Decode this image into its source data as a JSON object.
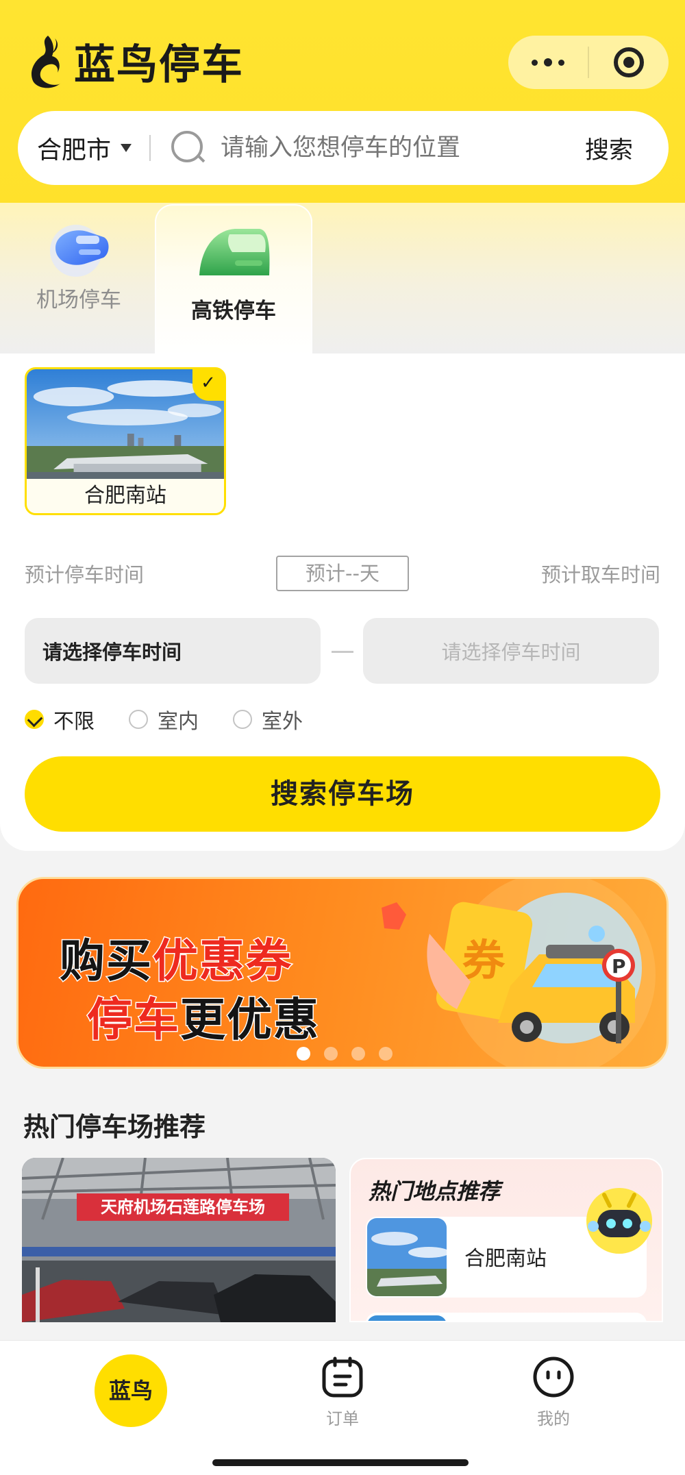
{
  "app": {
    "name": "蓝鸟停车",
    "accent_color": "#ffde00",
    "icons": {
      "logo": "bird-flame-logo",
      "more": "more-dots-icon",
      "close": "target-circle-icon"
    }
  },
  "search": {
    "city": "合肥市",
    "placeholder": "请输入您想停车的位置",
    "button": "搜索"
  },
  "tabs": [
    {
      "label": "机场停车",
      "icon": "airplane-icon",
      "active": false
    },
    {
      "label": "高铁停车",
      "icon": "high-speed-train-icon",
      "active": true
    }
  ],
  "station": {
    "name": "合肥南站",
    "selected": true
  },
  "time": {
    "park_label": "预计停车时间",
    "days_label": "预计--天",
    "pickup_label": "预计取车时间",
    "park_placeholder": "请选择停车时间",
    "pickup_placeholder": "请选择停车时间"
  },
  "options": [
    {
      "label": "不限",
      "checked": true
    },
    {
      "label": "室内",
      "checked": false
    },
    {
      "label": "室外",
      "checked": false
    }
  ],
  "search_button": "搜索停车场",
  "banner": {
    "line1_a": "购买",
    "line1_b": "优惠券",
    "line2_a": "停车",
    "line2_b": "更优惠",
    "ticket_text": "券",
    "parking_sign": "P",
    "page_count": 4,
    "active_page": 1
  },
  "recommend": {
    "title": "热门停车场推荐",
    "lot_sign": "天府机场石莲路停车场",
    "hot_title": "热门地点推荐",
    "hot_items": [
      {
        "name": "合肥南站"
      }
    ]
  },
  "tabbar": {
    "home": "蓝鸟",
    "order": "订单",
    "mine": "我的"
  }
}
